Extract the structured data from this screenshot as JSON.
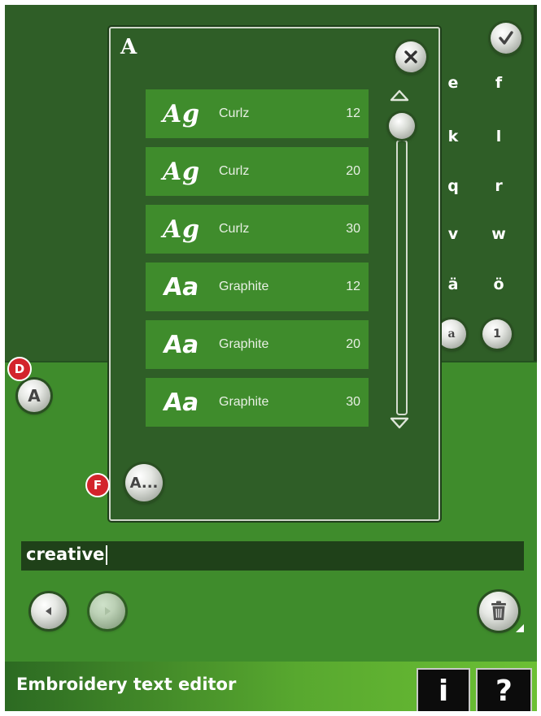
{
  "keyboard": {
    "rows": [
      [
        "e",
        "f"
      ],
      [
        "k",
        "l"
      ],
      [
        "q",
        "r"
      ],
      [
        "v",
        "w"
      ],
      [
        "ä",
        "ö"
      ]
    ],
    "mode_lower": "a",
    "mode_number": "1"
  },
  "confirm_icon": "check-icon",
  "font_panel": {
    "letter": "A",
    "close_icon": "close-icon",
    "fonts": [
      {
        "name": "Curlz",
        "size": "12",
        "sample": "Ag",
        "style": "curlz"
      },
      {
        "name": "Curlz",
        "size": "20",
        "sample": "Ag",
        "style": "curlz"
      },
      {
        "name": "Curlz",
        "size": "30",
        "sample": "Ag",
        "style": "curlz"
      },
      {
        "name": "Graphite",
        "size": "12",
        "sample": "Aa",
        "style": "graphite"
      },
      {
        "name": "Graphite",
        "size": "20",
        "sample": "Aa",
        "style": "graphite"
      },
      {
        "name": "Graphite",
        "size": "30",
        "sample": "Aa",
        "style": "graphite"
      }
    ],
    "more_fonts_label": "A..."
  },
  "font_button_label": "A",
  "markers": {
    "d": "D",
    "f": "F"
  },
  "text_field": {
    "value": "creative"
  },
  "footer": {
    "title": "Embroidery text editor",
    "info": "i",
    "help": "?"
  },
  "colors": {
    "background": "#3f8c2c",
    "panel": "#2f5e27",
    "marker": "#d3242c"
  }
}
